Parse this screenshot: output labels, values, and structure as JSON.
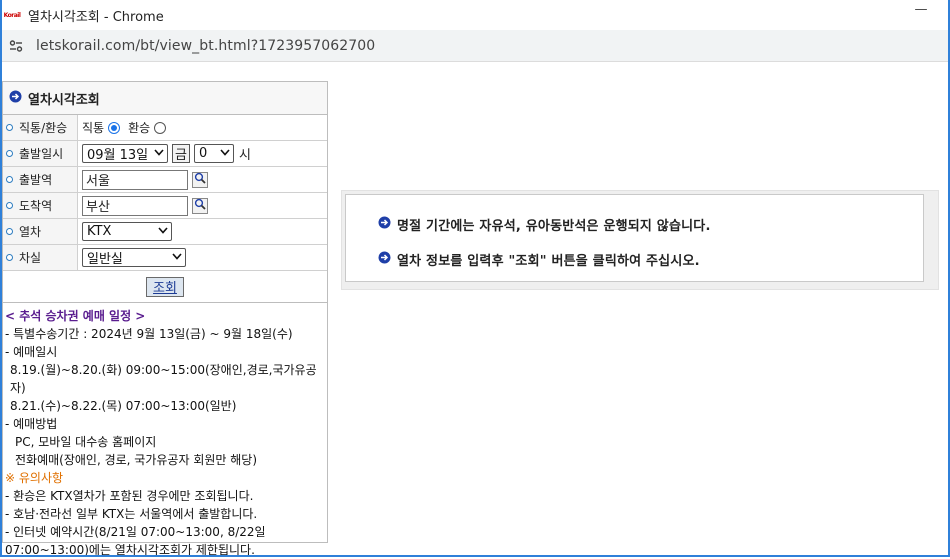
{
  "window": {
    "title": "열차시각조회 - Chrome",
    "favicon_text": "Korail",
    "minimize_glyph": "—"
  },
  "address": {
    "url": "letskorail.com/bt/view_bt.html?1723957062700"
  },
  "panel": {
    "title": "열차시각조회",
    "rows": {
      "transfer": {
        "label": "직통/환승",
        "direct": "직통",
        "transfer": "환승",
        "selected": "직통"
      },
      "date": {
        "label": "출발일시",
        "date_value": "09월 13일",
        "day": "금",
        "hour_value": "0",
        "hour_unit": "시"
      },
      "departure": {
        "label": "출발역",
        "value": "서울"
      },
      "arrival": {
        "label": "도착역",
        "value": "부산"
      },
      "train": {
        "label": "열차",
        "value": "KTX"
      },
      "car": {
        "label": "차실",
        "value": "일반실"
      }
    },
    "submit_label": "조회"
  },
  "notice": {
    "heading": "< 추석 승차권 예매 일정 >",
    "lines": [
      "- 특별수송기간 : 2024년 9월 13일(금) ~ 9월 18일(수)",
      "- 예매일시",
      "8.19.(월)~8.20.(화) 09:00~15:00(장애인,경로,국가유공자)",
      "8.21.(수)~8.22.(목) 07:00~13:00(일반)",
      "- 예매방법",
      "PC, 모바일 대수송 홈페이지",
      "전화예매(장애인, 경로, 국가유공자 회원만 해당)"
    ],
    "caution_heading": "※ 유의사항",
    "caution_lines": [
      "- 환승은 KTX열차가 포함된 경우에만 조회됩니다.",
      "- 호남·전라선 일부 KTX는 서울역에서 출발합니다.",
      "- 인터넷 예약시간(8/21일 07:00~13:00, 8/22일",
      "07:00~13:00)에는 열차시각조회가 제한됩니다."
    ]
  },
  "info": {
    "line1": "명절 기간에는 자유석, 유아동반석은 운행되지 않습니다.",
    "line2": "열차 정보를 입력후 \"조회\" 버튼을 클릭하여 주십시오."
  },
  "colors": {
    "frame": "#2f80d9",
    "arrow_icon": "#1f3fa8",
    "heading": "#5a1d8f",
    "warning": "#e07000"
  }
}
